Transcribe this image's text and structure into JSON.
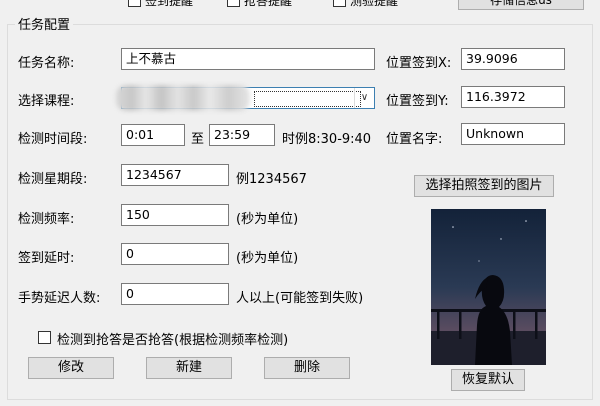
{
  "top": {
    "checkbox_labels": [
      "签到提醒",
      "抢答提醒",
      "测验提醒"
    ],
    "save_label": "存储信息us"
  },
  "group_title": "任务配置",
  "task_name": {
    "label": "任务名称:",
    "value": "上不慕古"
  },
  "course": {
    "label": "选择课程:",
    "value": ""
  },
  "time_range": {
    "label": "检测时间段:",
    "start": "0:01",
    "to": "至",
    "end": "23:59",
    "hint": "时例8:30-9:40"
  },
  "weekdays": {
    "label": "检测星期段:",
    "value": "1234567",
    "hint": "例1234567"
  },
  "frequency": {
    "label": "检测频率:",
    "value": "150",
    "hint": "(秒为单位)"
  },
  "signin_delay": {
    "label": "签到延时:",
    "value": "0",
    "hint": "(秒为单位)"
  },
  "gesture_delay": {
    "label": "手势延迟人数:",
    "value": "0",
    "hint": "人以上(可能签到失败)"
  },
  "location_x": {
    "label": "位置签到X:",
    "value": "39.9096"
  },
  "location_y": {
    "label": "位置签到Y:",
    "value": "116.3972"
  },
  "location_name": {
    "label": "位置名字:",
    "value": "Unknown"
  },
  "choose_photo_label": "选择拍照签到的图片",
  "restore_default_label": "恢复默认",
  "grab_answer": {
    "label": "检测到抢答是否抢答(根据检测频率检测)",
    "checked": false
  },
  "actions": {
    "modify": "修改",
    "create": "新建",
    "delete": "删除"
  },
  "icons": {
    "dropdown": "chevron-down-icon"
  }
}
